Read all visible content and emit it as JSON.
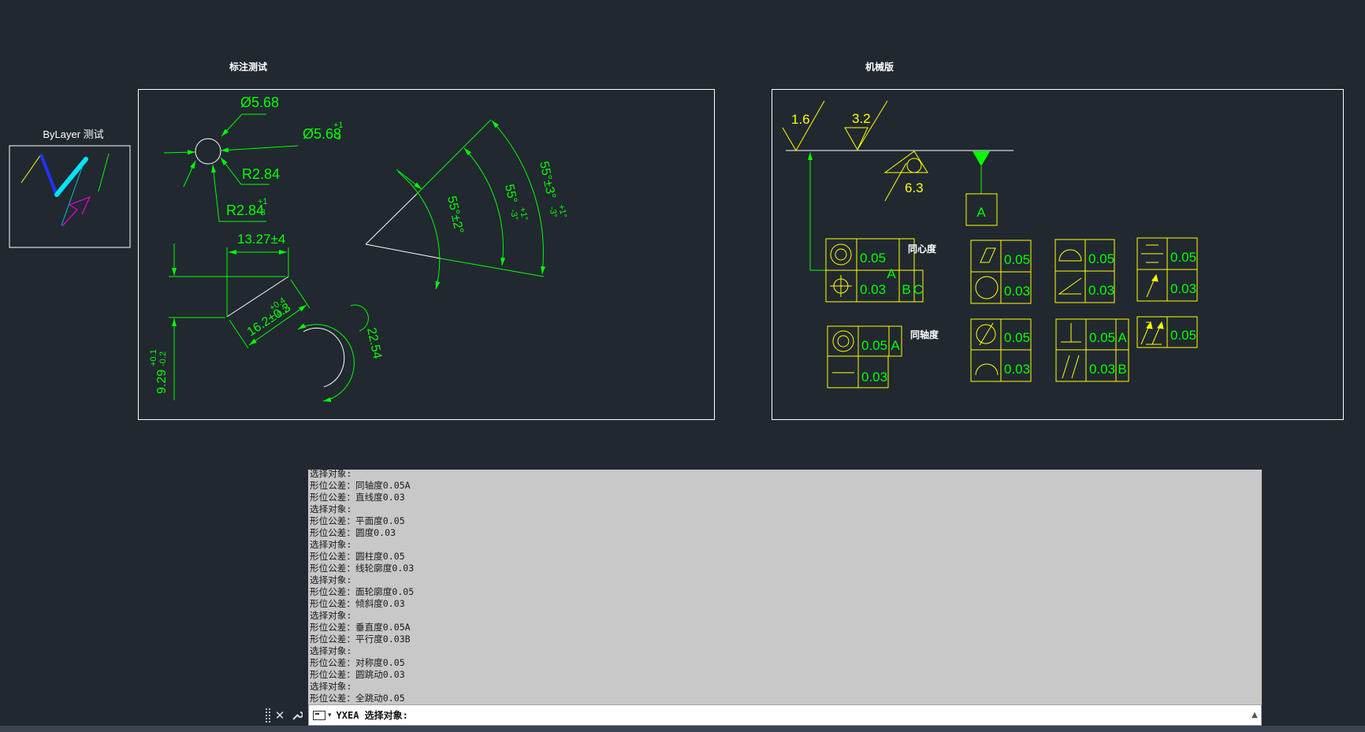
{
  "colors": {
    "background": "#212830",
    "dimension": "#00ff00",
    "tolerance": "#ffff00",
    "frame": "#ffffff",
    "command_bg": "#c8c8c8"
  },
  "panels": {
    "bylayer_title": "ByLayer 测试",
    "dimension_title": "标注测试",
    "mech_title": "机械版"
  },
  "dimensions": {
    "dia1": "Ø5.68",
    "dia2": "Ø5.68",
    "dia2_tol_upper": "+1",
    "dia2_tol_lower": "-3",
    "r1": "R2.84",
    "r2": "R2.84",
    "r2_tol_upper": "+1",
    "r2_tol_lower": "-3",
    "linear_top": "13.27±4",
    "aligned": "16.2±0.3",
    "aligned_tol_upper": "+0.4",
    "aligned_tol_lower": "-0.2",
    "vertical": "9.29",
    "vertical_tol_upper": "+0.1",
    "vertical_tol_lower": "-0.2",
    "arc_len": "22.54",
    "angle1": "55°±2°",
    "angle2": "55°",
    "angle2_tol_upper": "+1°",
    "angle2_tol_lower": "-3°",
    "angle3": "55°±3°",
    "angle3_tol_upper": "+1°",
    "angle3_tol_lower": "-3°"
  },
  "roughness": {
    "r1": "1.6",
    "r2": "3.2",
    "r3": "6.3",
    "datum": "A"
  },
  "tolerance_frames": {
    "f1_val1": "0.05",
    "f1_val2": "0.03",
    "f1_datum1": "A",
    "f1_datum2": "B",
    "f1_datum3": "C",
    "f1_note": "同心度",
    "f2_val1": "0.05",
    "f2_val2": "0.03",
    "f2_datum": "A",
    "f2_note": "同轴度",
    "f3_val1": "0.05",
    "f3_val2": "0.03",
    "f4_val1": "0.05",
    "f4_val2": "0.03",
    "f5_val1": "0.05",
    "f5_val2": "0.03",
    "f6_val1": "0.05",
    "f6_val2": "0.03",
    "f6_datum1": "A",
    "f6_datum2": "B",
    "f7_val1": "0.05",
    "f7_val2": "0.03",
    "f8_val1": "0.05",
    "f8_val2": "0.03",
    "f9_val1": "0.05"
  },
  "command_line": {
    "history": [
      "选择对象:",
      "形位公差：同轴度0.05A",
      "形位公差：直线度0.03",
      "选择对象:",
      "形位公差：平面度0.05",
      "形位公差：圆度0.03",
      "选择对象:",
      "形位公差：圆柱度0.05",
      "形位公差：线轮廓度0.03",
      "选择对象:",
      "形位公差：面轮廓度0.05",
      "形位公差：倾斜度0.03",
      "选择对象:",
      "形位公差：垂直度0.05A",
      "形位公差：平行度0.03B",
      "选择对象:",
      "形位公差：对称度0.05",
      "形位公差：圆跳动0.03",
      "选择对象:",
      "形位公差：全跳动0.05"
    ],
    "prompt": "YXEA 选择对象:",
    "input_value": ""
  }
}
